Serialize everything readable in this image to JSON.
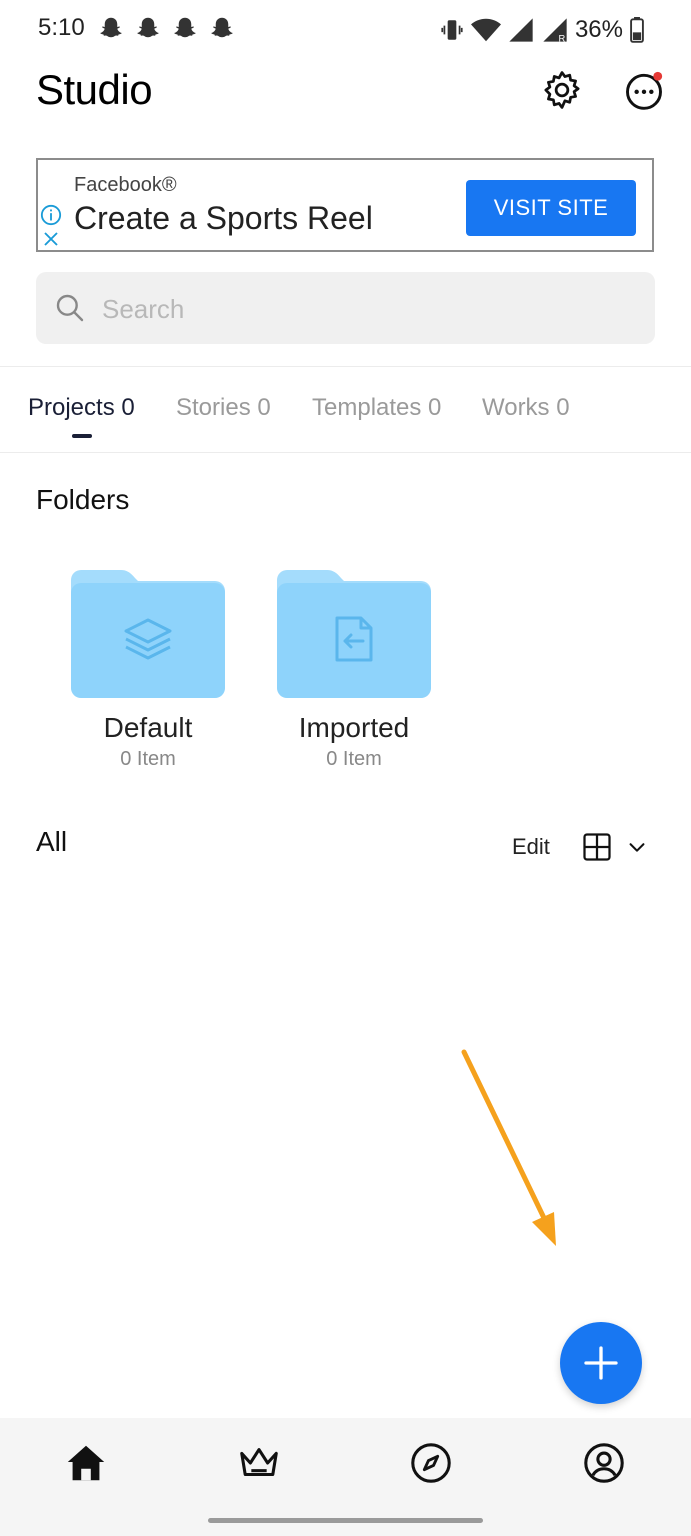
{
  "status_bar": {
    "time": "5:10",
    "battery": "36%",
    "icons": [
      "snapchat-icon",
      "snapchat-icon",
      "snapchat-icon",
      "snapchat-icon",
      "vibrate-icon",
      "wifi-icon",
      "signal-icon",
      "signal-roaming-icon",
      "battery-icon"
    ]
  },
  "header": {
    "title": "Studio",
    "icons": [
      "gear-icon",
      "more-options-icon"
    ],
    "notification_dot_color": "#e53935"
  },
  "ad": {
    "source": "Facebook®",
    "headline": "Create a Sports Reel",
    "cta": "VISIT SITE",
    "accent": "#1877f2",
    "icons": [
      "info-icon",
      "close-icon"
    ]
  },
  "search": {
    "placeholder": "Search",
    "value": ""
  },
  "tabs": [
    {
      "label": "Projects 0",
      "active": true
    },
    {
      "label": "Stories 0",
      "active": false
    },
    {
      "label": "Templates 0",
      "active": false
    },
    {
      "label": "Works 0",
      "active": false
    }
  ],
  "folders_section": {
    "title": "Folders",
    "folder_color": "#8ed3fb",
    "items": [
      {
        "name": "Default",
        "count": "0 Item",
        "icon": "layers-icon"
      },
      {
        "name": "Imported",
        "count": "0 Item",
        "icon": "import-file-icon"
      }
    ]
  },
  "all_section": {
    "title": "All",
    "edit_label": "Edit",
    "icons": [
      "grid-view-icon",
      "chevron-down-icon"
    ]
  },
  "annotation": {
    "color": "#f5a11d",
    "icon": "arrow-annotation"
  },
  "fab": {
    "icon": "plus-icon",
    "color": "#1877f2"
  },
  "bottom_nav": {
    "items": [
      "home-icon",
      "crown-icon",
      "compass-icon",
      "profile-icon"
    ]
  }
}
